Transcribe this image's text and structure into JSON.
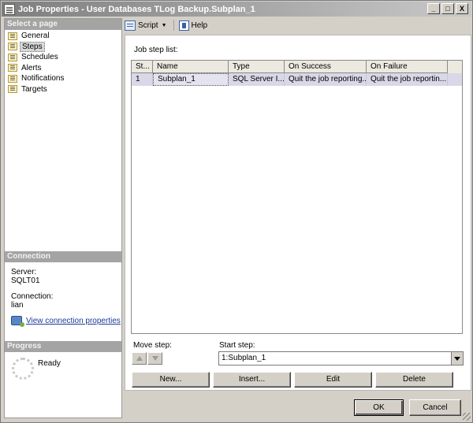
{
  "window": {
    "title": "Job Properties - User Databases TLog Backup.Subplan_1",
    "controls": [
      "_",
      "□",
      "X"
    ]
  },
  "left_pane": {
    "select_page_header": "Select a page",
    "pages": [
      {
        "label": "General",
        "icon": "page-icon",
        "selected": false
      },
      {
        "label": "Steps",
        "icon": "page-icon",
        "selected": true
      },
      {
        "label": "Schedules",
        "icon": "page-icon",
        "selected": false
      },
      {
        "label": "Alerts",
        "icon": "page-icon",
        "selected": false
      },
      {
        "label": "Notifications",
        "icon": "page-icon",
        "selected": false
      },
      {
        "label": "Targets",
        "icon": "page-icon",
        "selected": false
      }
    ],
    "connection_header": "Connection",
    "server_label": "Server:",
    "server_value": "SQLT01",
    "connection_label": "Connection:",
    "connection_value": "lian",
    "view_connection_link": "View connection properties",
    "progress_header": "Progress",
    "progress_status": "Ready"
  },
  "toolbar": {
    "script_label": "Script",
    "help_label": "Help"
  },
  "steps": {
    "list_label": "Job step list:",
    "columns": [
      "St...",
      "Name",
      "Type",
      "On Success",
      "On Failure"
    ],
    "rows": [
      {
        "step": "1",
        "name": "Subplan_1",
        "type": "SQL Server I...",
        "on_success": "Quit the job reporting...",
        "on_failure": "Quit the job reportin..."
      }
    ],
    "move_step_label": "Move step:",
    "start_step_label": "Start step:",
    "start_step_value": "1:Subplan_1",
    "new_button": "New...",
    "insert_button": "Insert...",
    "edit_button": "Edit",
    "delete_button": "Delete"
  },
  "footer": {
    "ok_button": "OK",
    "cancel_button": "Cancel"
  },
  "colors": {
    "dialog_background": "#d4d0c8",
    "section_header": "#a4a4a4",
    "selected_row": "#d8d8e8",
    "link": "#1a3a9a"
  }
}
